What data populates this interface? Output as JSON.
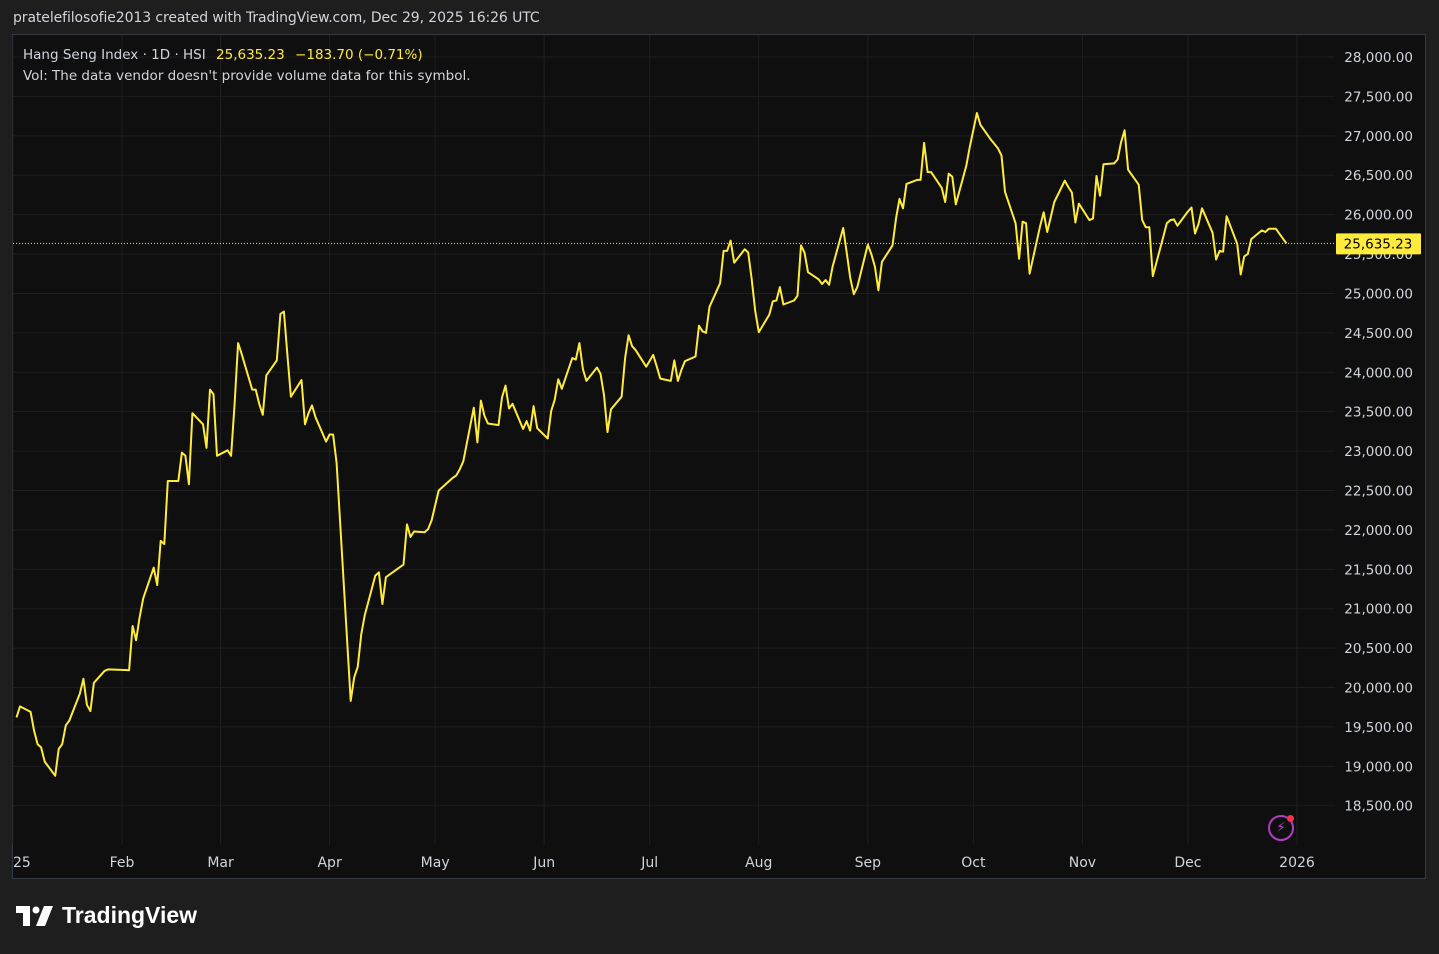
{
  "header": {
    "text": "pratelefilosofie2013 created with TradingView.com, Dec 29, 2025 16:26 UTC"
  },
  "legend": {
    "symbol": "Hang Seng Index · 1D · HSI",
    "last": "25,635.23",
    "change": "−183.70 (−0.71%)",
    "vol_note": "Vol: The data vendor doesn't provide volume data for this symbol."
  },
  "price_label": "25,635.23",
  "footer": {
    "brand": "TradingView",
    "logo_icon": "tradingview-logo-icon"
  },
  "colors": {
    "line": "#ffeb3b",
    "background": "#0f0f0f",
    "grid": "#1f1f1f",
    "axis_text": "#d1d4dc"
  },
  "chart_data": {
    "type": "line",
    "ylim": [
      18100,
      28250
    ],
    "yticks": [
      28000,
      27500,
      27000,
      26500,
      26000,
      25500,
      25000,
      24500,
      24000,
      23500,
      23000,
      22500,
      22000,
      21500,
      21000,
      20500,
      20000,
      19500,
      19000,
      18500
    ],
    "ytick_labels": [
      "28,000.00",
      "27,500.00",
      "27,000.00",
      "26,500.00",
      "26,000.00",
      "25,500.00",
      "25,000.00",
      "24,500.00",
      "24,000.00",
      "23,500.00",
      "23,000.00",
      "22,500.00",
      "22,000.00",
      "21,500.00",
      "21,000.00",
      "20,500.00",
      "20,000.00",
      "19,500.00",
      "19,000.00",
      "18,500.00"
    ],
    "xticks": [
      {
        "label": "25",
        "date": "2025-01-01"
      },
      {
        "label": "Feb",
        "date": "2025-02-01"
      },
      {
        "label": "Mar",
        "date": "2025-03-01"
      },
      {
        "label": "Apr",
        "date": "2025-04-01"
      },
      {
        "label": "May",
        "date": "2025-05-01"
      },
      {
        "label": "Jun",
        "date": "2025-06-01"
      },
      {
        "label": "Jul",
        "date": "2025-07-01"
      },
      {
        "label": "Aug",
        "date": "2025-08-01"
      },
      {
        "label": "Sep",
        "date": "2025-09-01"
      },
      {
        "label": "Oct",
        "date": "2025-10-01"
      },
      {
        "label": "Nov",
        "date": "2025-11-01"
      },
      {
        "label": "Dec",
        "date": "2025-12-01"
      },
      {
        "label": "2026",
        "date": "2026-01-01"
      }
    ],
    "last_value": 25635.23,
    "series": [
      {
        "points": [
          [
            "2025-01-02",
            19620
          ],
          [
            "2025-01-03",
            19760
          ],
          [
            "2025-01-06",
            19690
          ],
          [
            "2025-01-07",
            19450
          ],
          [
            "2025-01-08",
            19280
          ],
          [
            "2025-01-09",
            19240
          ],
          [
            "2025-01-10",
            19060
          ],
          [
            "2025-01-13",
            18880
          ],
          [
            "2025-01-14",
            19220
          ],
          [
            "2025-01-15",
            19280
          ],
          [
            "2025-01-16",
            19520
          ],
          [
            "2025-01-17",
            19580
          ],
          [
            "2025-01-20",
            19920
          ],
          [
            "2025-01-21",
            20110
          ],
          [
            "2025-01-22",
            19780
          ],
          [
            "2025-01-23",
            19700
          ],
          [
            "2025-01-24",
            20060
          ],
          [
            "2025-01-27",
            20210
          ],
          [
            "2025-01-28",
            20230
          ],
          [
            "2025-02-03",
            20220
          ],
          [
            "2025-02-04",
            20780
          ],
          [
            "2025-02-05",
            20600
          ],
          [
            "2025-02-06",
            20890
          ],
          [
            "2025-02-07",
            21130
          ],
          [
            "2025-02-10",
            21520
          ],
          [
            "2025-02-11",
            21300
          ],
          [
            "2025-02-12",
            21860
          ],
          [
            "2025-02-13",
            21820
          ],
          [
            "2025-02-14",
            22620
          ],
          [
            "2025-02-17",
            22620
          ],
          [
            "2025-02-18",
            22980
          ],
          [
            "2025-02-19",
            22940
          ],
          [
            "2025-02-20",
            22580
          ],
          [
            "2025-02-21",
            23480
          ],
          [
            "2025-02-24",
            23340
          ],
          [
            "2025-02-25",
            23040
          ],
          [
            "2025-02-26",
            23780
          ],
          [
            "2025-02-27",
            23720
          ],
          [
            "2025-02-28",
            22940
          ],
          [
            "2025-03-03",
            23010
          ],
          [
            "2025-03-04",
            22940
          ],
          [
            "2025-03-05",
            23600
          ],
          [
            "2025-03-06",
            24370
          ],
          [
            "2025-03-07",
            24230
          ],
          [
            "2025-03-10",
            23780
          ],
          [
            "2025-03-11",
            23780
          ],
          [
            "2025-03-12",
            23600
          ],
          [
            "2025-03-13",
            23460
          ],
          [
            "2025-03-14",
            23960
          ],
          [
            "2025-03-17",
            24150
          ],
          [
            "2025-03-18",
            24740
          ],
          [
            "2025-03-19",
            24770
          ],
          [
            "2025-03-20",
            24220
          ],
          [
            "2025-03-21",
            23690
          ],
          [
            "2025-03-24",
            23900
          ],
          [
            "2025-03-25",
            23340
          ],
          [
            "2025-03-26",
            23480
          ],
          [
            "2025-03-27",
            23580
          ],
          [
            "2025-03-28",
            23430
          ],
          [
            "2025-03-31",
            23120
          ],
          [
            "2025-04-01",
            23210
          ],
          [
            "2025-04-02",
            23210
          ],
          [
            "2025-04-03",
            22850
          ],
          [
            "2025-04-07",
            19830
          ],
          [
            "2025-04-08",
            20130
          ],
          [
            "2025-04-09",
            20260
          ],
          [
            "2025-04-10",
            20680
          ],
          [
            "2025-04-11",
            20920
          ],
          [
            "2025-04-14",
            21420
          ],
          [
            "2025-04-15",
            21460
          ],
          [
            "2025-04-16",
            21060
          ],
          [
            "2025-04-17",
            21400
          ],
          [
            "2025-04-22",
            21560
          ],
          [
            "2025-04-23",
            22070
          ],
          [
            "2025-04-24",
            21910
          ],
          [
            "2025-04-25",
            21980
          ],
          [
            "2025-04-28",
            21970
          ],
          [
            "2025-04-29",
            22010
          ],
          [
            "2025-04-30",
            22120
          ],
          [
            "2025-05-02",
            22500
          ],
          [
            "2025-05-06",
            22660
          ],
          [
            "2025-05-07",
            22690
          ],
          [
            "2025-05-08",
            22770
          ],
          [
            "2025-05-09",
            22870
          ],
          [
            "2025-05-12",
            23550
          ],
          [
            "2025-05-13",
            23110
          ],
          [
            "2025-05-14",
            23640
          ],
          [
            "2025-05-15",
            23450
          ],
          [
            "2025-05-16",
            23350
          ],
          [
            "2025-05-19",
            23330
          ],
          [
            "2025-05-20",
            23680
          ],
          [
            "2025-05-21",
            23830
          ],
          [
            "2025-05-22",
            23540
          ],
          [
            "2025-05-23",
            23600
          ],
          [
            "2025-05-26",
            23280
          ],
          [
            "2025-05-27",
            23380
          ],
          [
            "2025-05-28",
            23260
          ],
          [
            "2025-05-29",
            23570
          ],
          [
            "2025-05-30",
            23290
          ],
          [
            "2025-06-02",
            23160
          ],
          [
            "2025-06-03",
            23510
          ],
          [
            "2025-06-04",
            23650
          ],
          [
            "2025-06-05",
            23910
          ],
          [
            "2025-06-06",
            23790
          ],
          [
            "2025-06-09",
            24180
          ],
          [
            "2025-06-10",
            24160
          ],
          [
            "2025-06-11",
            24370
          ],
          [
            "2025-06-12",
            24040
          ],
          [
            "2025-06-13",
            23890
          ],
          [
            "2025-06-16",
            24060
          ],
          [
            "2025-06-17",
            23980
          ],
          [
            "2025-06-18",
            23710
          ],
          [
            "2025-06-19",
            23240
          ],
          [
            "2025-06-20",
            23530
          ],
          [
            "2025-06-23",
            23690
          ],
          [
            "2025-06-24",
            24180
          ],
          [
            "2025-06-25",
            24470
          ],
          [
            "2025-06-26",
            24330
          ],
          [
            "2025-06-27",
            24280
          ],
          [
            "2025-06-30",
            24070
          ],
          [
            "2025-07-02",
            24220
          ],
          [
            "2025-07-03",
            24070
          ],
          [
            "2025-07-04",
            23920
          ],
          [
            "2025-07-07",
            23890
          ],
          [
            "2025-07-08",
            24150
          ],
          [
            "2025-07-09",
            23890
          ],
          [
            "2025-07-10",
            24030
          ],
          [
            "2025-07-11",
            24140
          ],
          [
            "2025-07-14",
            24200
          ],
          [
            "2025-07-15",
            24590
          ],
          [
            "2025-07-16",
            24520
          ],
          [
            "2025-07-17",
            24500
          ],
          [
            "2025-07-18",
            24830
          ],
          [
            "2025-07-21",
            25130
          ],
          [
            "2025-07-22",
            25540
          ],
          [
            "2025-07-23",
            25540
          ],
          [
            "2025-07-24",
            25670
          ],
          [
            "2025-07-25",
            25390
          ],
          [
            "2025-07-28",
            25560
          ],
          [
            "2025-07-29",
            25520
          ],
          [
            "2025-07-30",
            25180
          ],
          [
            "2025-07-31",
            24770
          ],
          [
            "2025-08-01",
            24510
          ],
          [
            "2025-08-04",
            24730
          ],
          [
            "2025-08-05",
            24900
          ],
          [
            "2025-08-06",
            24910
          ],
          [
            "2025-08-07",
            25080
          ],
          [
            "2025-08-08",
            24860
          ],
          [
            "2025-08-11",
            24910
          ],
          [
            "2025-08-12",
            24970
          ],
          [
            "2025-08-13",
            25610
          ],
          [
            "2025-08-14",
            25520
          ],
          [
            "2025-08-15",
            25270
          ],
          [
            "2025-08-18",
            25180
          ],
          [
            "2025-08-19",
            25120
          ],
          [
            "2025-08-20",
            25170
          ],
          [
            "2025-08-21",
            25110
          ],
          [
            "2025-08-22",
            25340
          ],
          [
            "2025-08-25",
            25830
          ],
          [
            "2025-08-26",
            25520
          ],
          [
            "2025-08-27",
            25200
          ],
          [
            "2025-08-28",
            24990
          ],
          [
            "2025-08-29",
            25080
          ],
          [
            "2025-09-01",
            25620
          ],
          [
            "2025-09-02",
            25500
          ],
          [
            "2025-09-03",
            25340
          ],
          [
            "2025-09-04",
            25040
          ],
          [
            "2025-09-05",
            25400
          ],
          [
            "2025-09-08",
            25610
          ],
          [
            "2025-09-09",
            25950
          ],
          [
            "2025-09-10",
            26200
          ],
          [
            "2025-09-11",
            26080
          ],
          [
            "2025-09-12",
            26390
          ],
          [
            "2025-09-15",
            26440
          ],
          [
            "2025-09-16",
            26440
          ],
          [
            "2025-09-17",
            26910
          ],
          [
            "2025-09-18",
            26540
          ],
          [
            "2025-09-19",
            26540
          ],
          [
            "2025-09-22",
            26340
          ],
          [
            "2025-09-23",
            26160
          ],
          [
            "2025-09-24",
            26520
          ],
          [
            "2025-09-25",
            26480
          ],
          [
            "2025-09-26",
            26130
          ],
          [
            "2025-09-29",
            26620
          ],
          [
            "2025-09-30",
            26860
          ],
          [
            "2025-10-02",
            27290
          ],
          [
            "2025-10-03",
            27140
          ],
          [
            "2025-10-06",
            26950
          ],
          [
            "2025-10-08",
            26840
          ],
          [
            "2025-10-09",
            26750
          ],
          [
            "2025-10-10",
            26290
          ],
          [
            "2025-10-13",
            25890
          ],
          [
            "2025-10-14",
            25440
          ],
          [
            "2025-10-15",
            25910
          ],
          [
            "2025-10-16",
            25890
          ],
          [
            "2025-10-17",
            25250
          ],
          [
            "2025-10-20",
            25860
          ],
          [
            "2025-10-21",
            26030
          ],
          [
            "2025-10-22",
            25780
          ],
          [
            "2025-10-23",
            25970
          ],
          [
            "2025-10-24",
            26160
          ],
          [
            "2025-10-27",
            26430
          ],
          [
            "2025-10-28",
            26350
          ],
          [
            "2025-10-29",
            26280
          ],
          [
            "2025-10-30",
            25900
          ],
          [
            "2025-10-31",
            26140
          ],
          [
            "2025-11-03",
            25930
          ],
          [
            "2025-11-04",
            25950
          ],
          [
            "2025-11-05",
            26490
          ],
          [
            "2025-11-06",
            26240
          ],
          [
            "2025-11-07",
            26640
          ],
          [
            "2025-11-10",
            26650
          ],
          [
            "2025-11-11",
            26700
          ],
          [
            "2025-11-12",
            26920
          ],
          [
            "2025-11-13",
            27070
          ],
          [
            "2025-11-14",
            26570
          ],
          [
            "2025-11-17",
            26380
          ],
          [
            "2025-11-18",
            25930
          ],
          [
            "2025-11-19",
            25840
          ],
          [
            "2025-11-20",
            25840
          ],
          [
            "2025-11-21",
            25220
          ],
          [
            "2025-11-24",
            25720
          ],
          [
            "2025-11-25",
            25890
          ],
          [
            "2025-11-26",
            25930
          ],
          [
            "2025-11-27",
            25940
          ],
          [
            "2025-11-28",
            25860
          ],
          [
            "2025-12-01",
            26040
          ],
          [
            "2025-12-02",
            26090
          ],
          [
            "2025-12-03",
            25760
          ],
          [
            "2025-12-04",
            25880
          ],
          [
            "2025-12-05",
            26080
          ],
          [
            "2025-12-08",
            25770
          ],
          [
            "2025-12-09",
            25430
          ],
          [
            "2025-12-10",
            25540
          ],
          [
            "2025-12-11",
            25530
          ],
          [
            "2025-12-12",
            25980
          ],
          [
            "2025-12-15",
            25630
          ],
          [
            "2025-12-16",
            25240
          ],
          [
            "2025-12-17",
            25470
          ],
          [
            "2025-12-18",
            25500
          ],
          [
            "2025-12-19",
            25690
          ],
          [
            "2025-12-22",
            25800
          ],
          [
            "2025-12-23",
            25780
          ],
          [
            "2025-12-24",
            25820
          ],
          [
            "2025-12-26",
            25820
          ],
          [
            "2025-12-29",
            25635.23
          ]
        ]
      }
    ]
  }
}
